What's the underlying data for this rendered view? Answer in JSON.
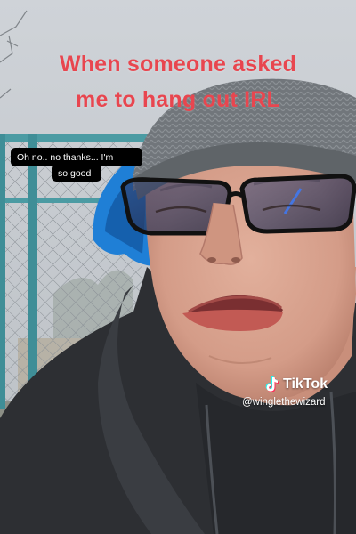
{
  "caption": {
    "line1": "When someone asked",
    "line2": "me to hang out IRL"
  },
  "speech_bubble": {
    "line1": "Oh no.. no thanks... I'm",
    "line2": "so good"
  },
  "watermark": {
    "brand": "TikTok",
    "handle": "@winglethewizard",
    "icon": "tiktok-logo-icon"
  },
  "colors": {
    "caption": "#e8464f",
    "sky": "#c9ced4",
    "hair": "#1f7fd6",
    "beanie": "#6f7377",
    "hoodie": "#2d2f33",
    "skin": "#d9a391"
  }
}
